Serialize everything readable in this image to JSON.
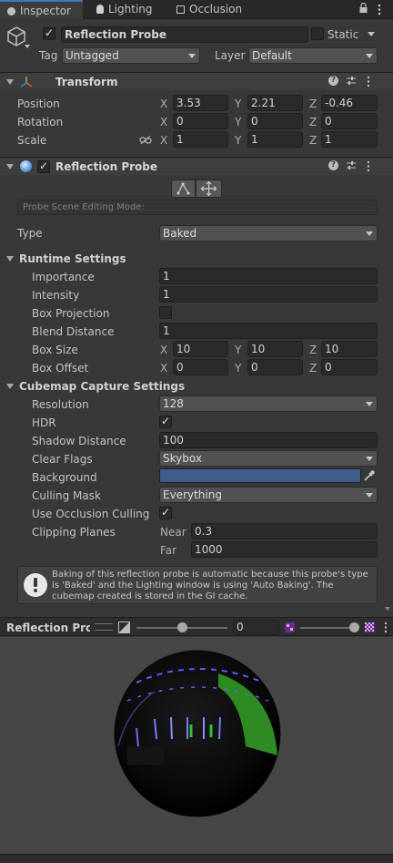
{
  "tabs": [
    {
      "label": "Inspector",
      "active": true
    },
    {
      "label": "Lighting",
      "active": false
    },
    {
      "label": "Occlusion",
      "active": false
    }
  ],
  "gameobject": {
    "name": "Reflection Probe",
    "active": true,
    "static_label": "Static",
    "static": false,
    "tag_label": "Tag",
    "tag_value": "Untagged",
    "layer_label": "Layer",
    "layer_value": "Default"
  },
  "transform": {
    "title": "Transform",
    "position_label": "Position",
    "rotation_label": "Rotation",
    "scale_label": "Scale",
    "position": {
      "x": "3.53",
      "y": "2.21",
      "z": "-0.46"
    },
    "rotation": {
      "x": "0",
      "y": "0",
      "z": "0"
    },
    "scale": {
      "x": "1",
      "y": "1",
      "z": "1"
    },
    "axis": {
      "x": "X",
      "y": "Y",
      "z": "Z"
    }
  },
  "probe": {
    "title": "Reflection Probe",
    "enabled": true,
    "editing_mode_placeholder": "Probe Scene Editing Mode:",
    "type_label": "Type",
    "type_value": "Baked",
    "runtime_section": "Runtime Settings",
    "importance_label": "Importance",
    "importance_value": "1",
    "intensity_label": "Intensity",
    "intensity_value": "1",
    "box_projection_label": "Box Projection",
    "box_projection": false,
    "blend_distance_label": "Blend Distance",
    "blend_distance_value": "1",
    "box_size_label": "Box Size",
    "box_size": {
      "x": "10",
      "y": "10",
      "z": "10"
    },
    "box_offset_label": "Box Offset",
    "box_offset": {
      "x": "0",
      "y": "0",
      "z": "0"
    },
    "cubemap_section": "Cubemap Capture Settings",
    "resolution_label": "Resolution",
    "resolution_value": "128",
    "hdr_label": "HDR",
    "hdr": true,
    "shadow_distance_label": "Shadow Distance",
    "shadow_distance_value": "100",
    "clear_flags_label": "Clear Flags",
    "clear_flags_value": "Skybox",
    "background_label": "Background",
    "background_color": "#3e5c8c",
    "culling_mask_label": "Culling Mask",
    "culling_mask_value": "Everything",
    "occlusion_label": "Use Occlusion Culling",
    "occlusion": true,
    "clipping_label": "Clipping Planes",
    "near_label": "Near",
    "near_value": "0.3",
    "far_label": "Far",
    "far_value": "1000",
    "help_text": "Baking of this reflection probe is automatic because this probe's type is 'Baked' and the Lighting window is using 'Auto Baking'. The cubemap created is stored in the GI cache."
  },
  "preview": {
    "title": "Reflection Probe",
    "exposure_value": "0"
  },
  "colors": {
    "accent": "#3a79bb",
    "panel": "#383838",
    "field": "#2a2a2a"
  }
}
